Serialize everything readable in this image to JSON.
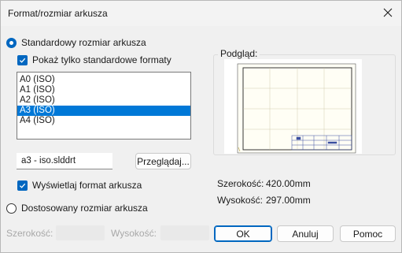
{
  "window": {
    "title": "Format/rozmiar arkusza"
  },
  "standard": {
    "radio_label": "Standardowy rozmiar arkusza",
    "only_standard_label": "Pokaż tylko standardowe formaty",
    "formats": [
      "A0 (ISO)",
      "A1 (ISO)",
      "A2 (ISO)",
      "A3 (ISO)",
      "A4 (ISO)"
    ],
    "selected_format": "A3 (ISO)",
    "template_file": "a3 - iso.slddrt",
    "browse_label": "Przeglądaj...",
    "show_format_label": "Wyświetlaj format arkusza"
  },
  "custom": {
    "radio_label": "Dostosowany rozmiar arkusza",
    "width_label": "Szerokość:",
    "height_label": "Wysokość:",
    "width_value": "",
    "height_value": ""
  },
  "preview": {
    "group_label": "Podgląd:",
    "width_label": "Szerokość:",
    "width_value": "420.00mm",
    "height_label": "Wysokość:",
    "height_value": "297.00mm"
  },
  "buttons": {
    "ok": "OK",
    "cancel": "Anuluj",
    "help": "Pomoc"
  },
  "colors": {
    "accent": "#0067c0",
    "selection": "#0078d7",
    "sheet_border": "#8a7a3a",
    "sheet_fill": "#fffef5"
  }
}
